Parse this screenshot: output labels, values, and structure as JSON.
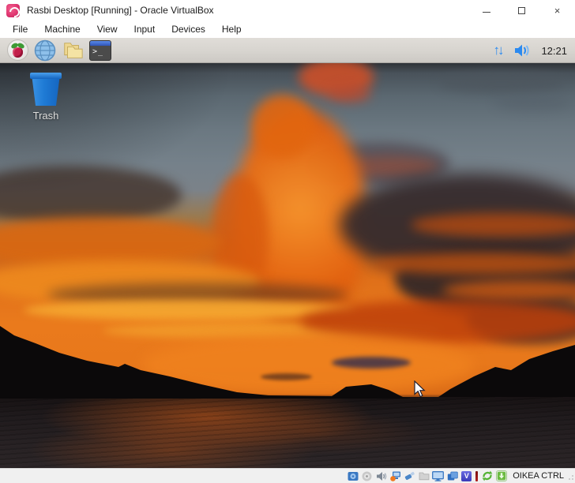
{
  "window": {
    "title": "Rasbi Desktop [Running] - Oracle VirtualBox",
    "controls": {
      "minimize_glyph": "",
      "maximize_glyph": "",
      "close_glyph": "×"
    }
  },
  "menubar": {
    "items": [
      "File",
      "Machine",
      "View",
      "Input",
      "Devices",
      "Help"
    ]
  },
  "guest": {
    "taskbar": {
      "launchers": [
        "raspberry-menu",
        "web-browser",
        "file-manager",
        "terminal"
      ],
      "updown_glyph": "↑↓",
      "clock": "12:21"
    },
    "desktop": {
      "icons": [
        {
          "label": "Trash"
        }
      ]
    }
  },
  "statusbar": {
    "icons": [
      "hard-disks",
      "optical-drives",
      "audio",
      "network",
      "usb",
      "shared-folders",
      "display",
      "recording",
      "features-chip",
      "activity-indicator",
      "mouse-integration",
      "keyboard-state"
    ],
    "host_key_label": "OIKEA CTRL"
  },
  "colors": {
    "accent_blue": "#2b8af0",
    "taskbar_bg": "#d7d4cf",
    "trash_blue": "#1e7ad4",
    "statusbar_bg": "#f0f0f0"
  }
}
